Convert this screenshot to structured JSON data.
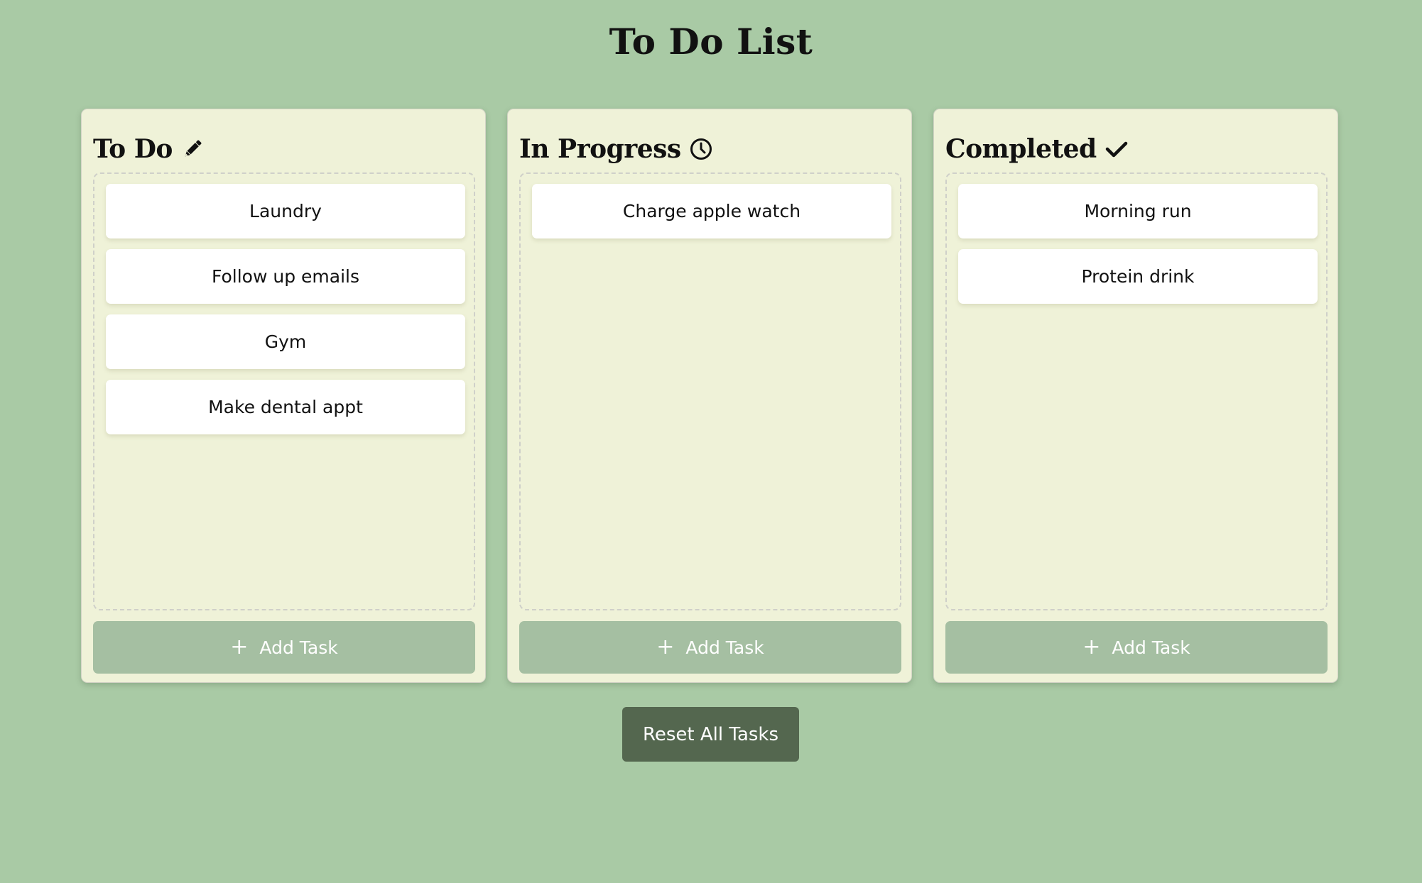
{
  "title": "To Do List",
  "colors": {
    "page_bg": "#a9caa5",
    "panel_bg": "#eff2d8",
    "add_button": "#a5bfa2",
    "reset_button": "#54674f"
  },
  "columns": [
    {
      "title": "To Do",
      "icon": "pencil-icon",
      "tasks": [
        "Laundry",
        "Follow up emails",
        "Gym",
        "Make dental appt"
      ],
      "add_label": "Add Task",
      "add_icon": "+"
    },
    {
      "title": "In Progress",
      "icon": "clock-icon",
      "tasks": [
        "Charge apple watch"
      ],
      "add_label": "Add Task",
      "add_icon": "+"
    },
    {
      "title": "Completed",
      "icon": "checkmark-icon",
      "tasks": [
        "Morning run",
        "Protein drink"
      ],
      "add_label": "Add Task",
      "add_icon": "+"
    }
  ],
  "reset_label": "Reset All Tasks"
}
